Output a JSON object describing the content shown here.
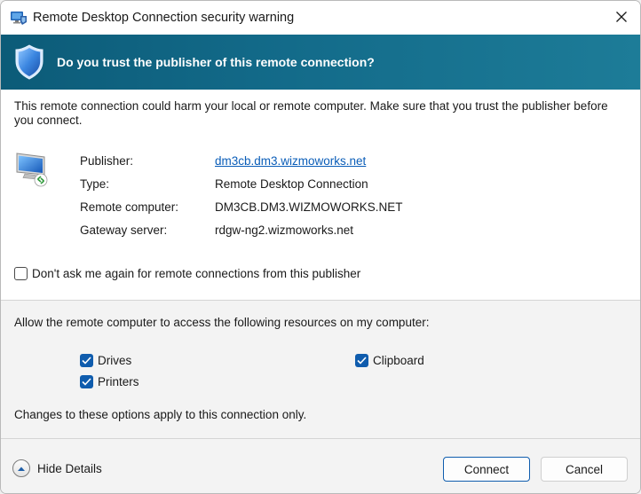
{
  "window": {
    "title": "Remote Desktop Connection security warning"
  },
  "banner": {
    "question": "Do you trust the publisher of this remote connection?"
  },
  "warning": {
    "text": "This remote connection could harm your local or remote computer. Make sure that you trust the publisher before you connect."
  },
  "details": {
    "rows": [
      {
        "label": "Publisher:",
        "value": "dm3cb.dm3.wizmoworks.net"
      },
      {
        "label": "Type:",
        "value": "Remote Desktop Connection"
      },
      {
        "label": "Remote computer:",
        "value": "DM3CB.DM3.WIZMOWORKS.NET"
      },
      {
        "label": "Gateway server:",
        "value": "rdgw-ng2.wizmoworks.net"
      }
    ]
  },
  "dont_ask": {
    "label": "Don't ask me again for remote connections from this publisher",
    "checked": false
  },
  "resources": {
    "heading": "Allow the remote computer to access the following resources on my computer:",
    "drives": {
      "label": "Drives",
      "checked": true
    },
    "clipboard": {
      "label": "Clipboard",
      "checked": true
    },
    "printers": {
      "label": "Printers",
      "checked": true
    },
    "note": "Changes to these options apply to this connection only."
  },
  "footer": {
    "hide_details_label": "Hide Details",
    "connect_label": "Connect",
    "cancel_label": "Cancel"
  },
  "colors": {
    "banner": "#0c5b78",
    "accent": "#0f5cad",
    "link": "#0a5db8"
  },
  "icons": [
    "rdp-app-icon",
    "close-icon",
    "shield-icon",
    "computer-icon",
    "checkmark-icon",
    "chevron-up-icon"
  ]
}
